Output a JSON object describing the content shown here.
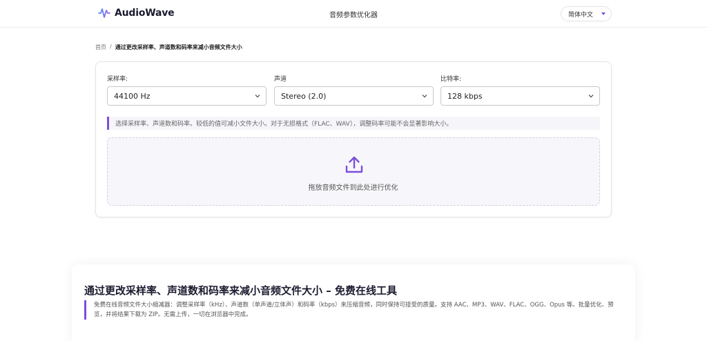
{
  "header": {
    "brand": "AudioWave",
    "title": "音频参数优化器",
    "language": "简体中文"
  },
  "breadcrumb": {
    "home": "首页",
    "separator": "/",
    "current": "通过更改采样率、声道数和码率来减小音频文件大小"
  },
  "settings": {
    "sample_rate": {
      "label": "采样率:",
      "value": "44100 Hz"
    },
    "channels": {
      "label": "声道",
      "value": "Stereo (2.0)"
    },
    "bitrate": {
      "label": "比特率:",
      "value": "128 kbps"
    },
    "hint": "选择采样率、声道数和码率。较低的值可减小文件大小。对于无损格式（FLAC、WAV），调整码率可能不会显著影响大小。"
  },
  "dropzone": {
    "label": "拖放音频文件到此处进行优化",
    "icon": "upload-icon"
  },
  "info": {
    "title": "通过更改采样率、声道数和码率来减小音频文件大小 – 免费在线工具",
    "description": "免费在线音频文件大小缩减器：调整采样率（kHz）、声道数（单声道/立体声）和码率（kbps）来压缩音频，同时保持可接受的质量。支持 AAC、MP3、WAV、FLAC、OGG、Opus 等。批量优化、预览，并将结果下载为 ZIP。无需上传，一切在浏览器中完成。"
  },
  "colors": {
    "accent": "#7c4ddc",
    "brand_dark": "#1a1a2e"
  }
}
